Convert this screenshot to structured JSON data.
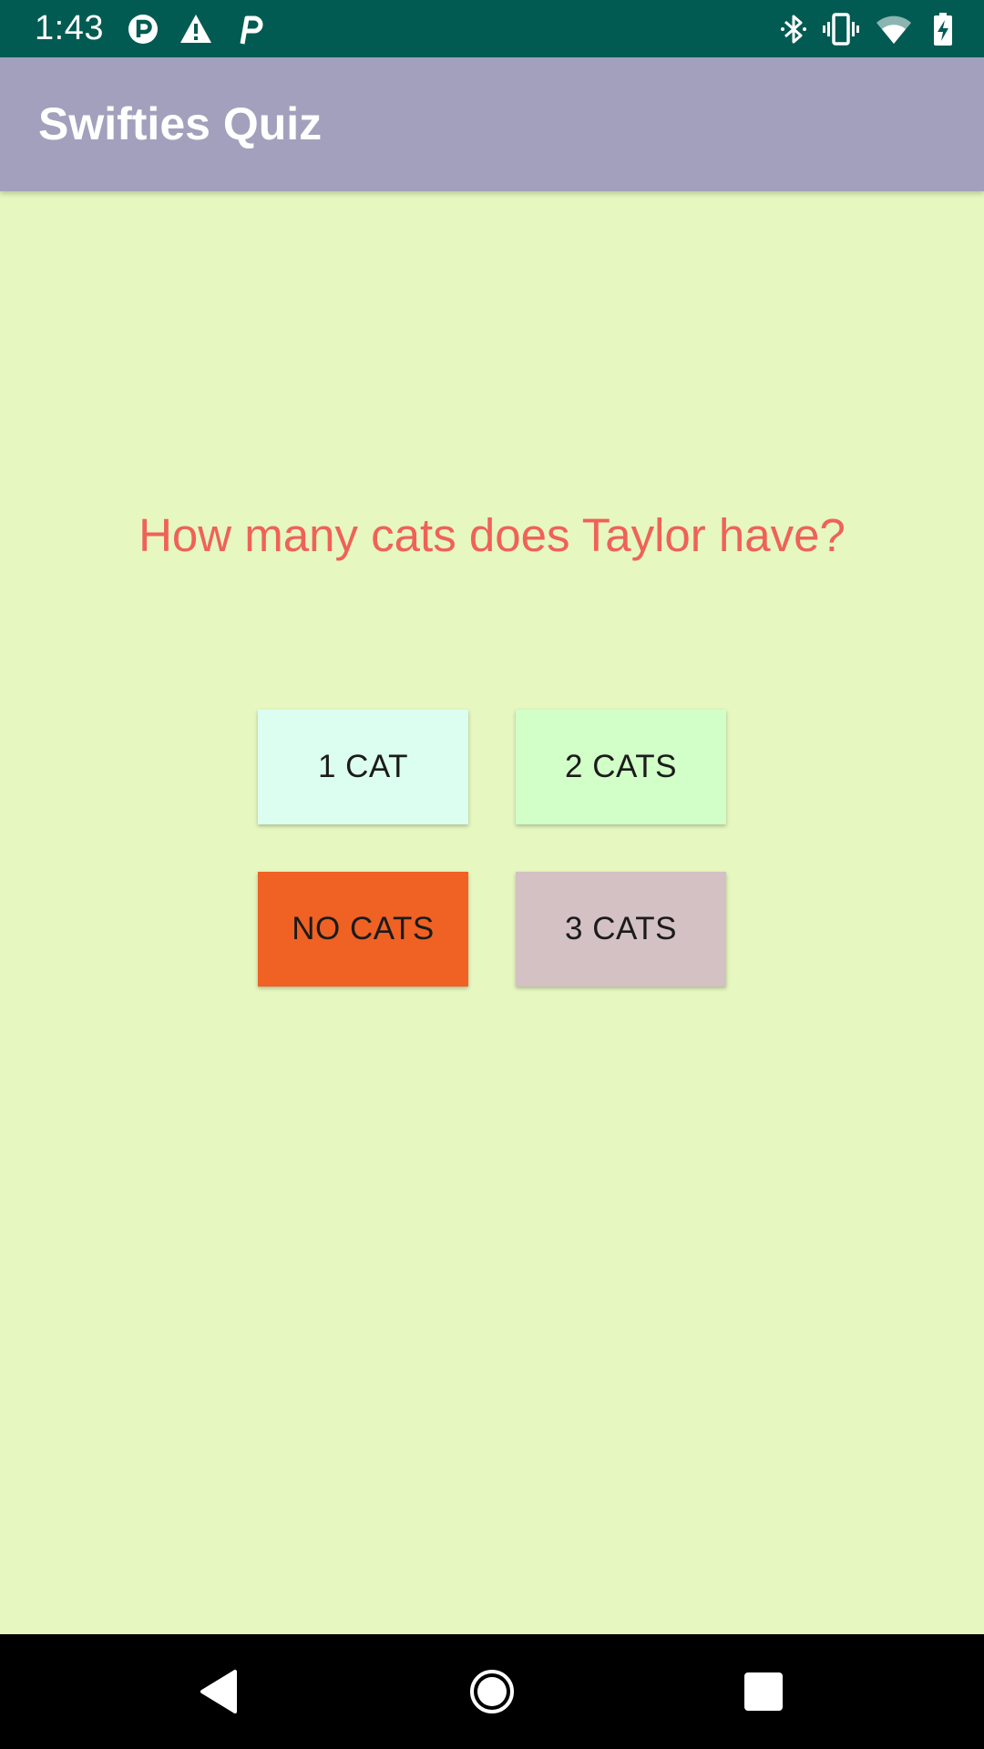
{
  "status_bar": {
    "time": "1:43",
    "icons_left": [
      "p-notification-icon",
      "warning-icon",
      "p-notification-icon"
    ],
    "icons_right": [
      "bluetooth-icon",
      "vibrate-icon",
      "wifi-icon",
      "battery-charging-icon"
    ],
    "background_color": "#015b52"
  },
  "app_bar": {
    "title": "Swifties Quiz",
    "background_color": "#a3a0bd"
  },
  "quiz": {
    "question": "How many cats does Taylor have?",
    "question_color": "#ef6258",
    "answers": [
      {
        "label": "1 CAT",
        "color": "#dcfef1"
      },
      {
        "label": "2 CATS",
        "color": "#d2fec8"
      },
      {
        "label": "NO CATS",
        "color": "#f06124"
      },
      {
        "label": "3 CATS",
        "color": "#d4c1c4"
      }
    ],
    "background_color": "#e6f7c0"
  },
  "nav_bar": {
    "buttons": [
      "back-icon",
      "home-icon",
      "recents-icon"
    ]
  }
}
